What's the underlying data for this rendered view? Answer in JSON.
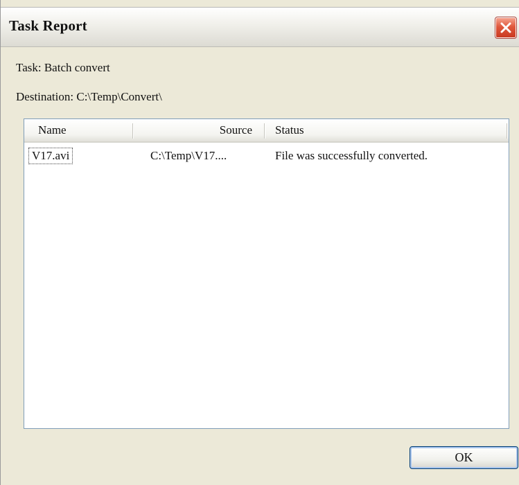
{
  "window": {
    "title": "Task Report",
    "close_icon": "close-icon"
  },
  "info": {
    "task_line": "Task: Batch convert",
    "destination_line": "Destination: C:\\Temp\\Convert\\"
  },
  "list": {
    "columns": [
      "Name",
      "Source",
      "Status"
    ],
    "rows": [
      {
        "name": "V17.avi",
        "source": "C:\\Temp\\V17....",
        "status": "File was successfully converted."
      }
    ]
  },
  "buttons": {
    "ok_label": "OK"
  },
  "colors": {
    "close_button": "#e0583c",
    "list_border": "#7f9db9",
    "dialog_background": "#ece9d8"
  }
}
